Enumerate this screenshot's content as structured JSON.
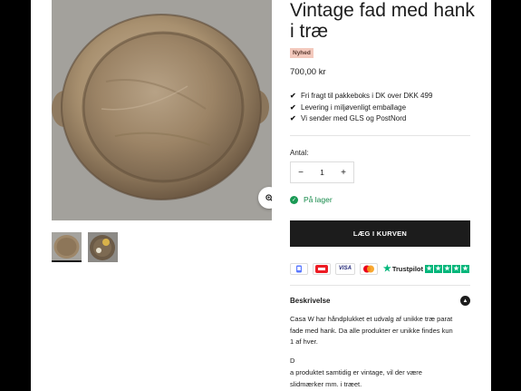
{
  "product": {
    "title": "Vintage fad med hank i træ",
    "badge": "Nyhed",
    "price": "700,00 kr",
    "usps": [
      "Fri fragt til pakkeboks i DK over DKK 499",
      "Levering i miljøvenligt emballage",
      "Vi sender med GLS og PostNord"
    ],
    "check_glyph": "✔",
    "quantity": {
      "label": "Antal:",
      "value": "1",
      "minus": "−",
      "plus": "+"
    },
    "stock": "På lager",
    "add_to_cart": "LÆG I KURVEN",
    "payments": {
      "visa": "VISA",
      "trustpilot": "Trustpilot",
      "trustpilot_star": "★",
      "stars": [
        "★",
        "★",
        "★",
        "★",
        "★"
      ]
    },
    "description": {
      "label": "Beskrivelse",
      "toggle": "▲",
      "paragraph_1": "Casa W har håndplukket et udvalg af unikke træ parat fade med hank. Da alle produkter er unikke findes kun 1 af hver.",
      "paragraph_2": "D",
      "paragraph_3": "a produktet samtidig er vintage, vil der være slidmærker mm. i træet."
    }
  },
  "colors": {
    "accent": "#1c1c1c",
    "badge_bg": "#f3c9bd",
    "stock_green": "#1a9a55",
    "trustpilot_green": "#00b67a"
  },
  "icons": {
    "zoom": "zoom-icon",
    "check": "check-icon",
    "stock": "check-circle-icon",
    "toggle": "chevron-up-icon"
  }
}
